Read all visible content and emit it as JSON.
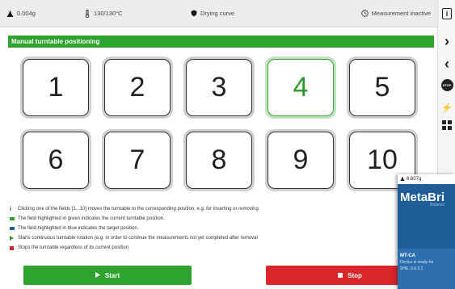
{
  "status_bar": {
    "weight": "0.004g",
    "temperature": "130/130°C",
    "drying_curve": "Drying curve",
    "measurement": "Measurement inactive"
  },
  "panel": {
    "title": "Manual turntable positioning",
    "active_position": "4",
    "positions": [
      "1",
      "2",
      "3",
      "4",
      "5",
      "6",
      "7",
      "8",
      "9",
      "10"
    ]
  },
  "legend": {
    "info": "Clicking one of the fields [1...10] moves the turntable to the corresponding position, e.g. for inserting or removing",
    "green": "The field highlighted in green indicates the current turntable position.",
    "blue": "The field highlighted in blue indicates the target position.",
    "start": "Starts continuous turntable rotation (e.g. in order to continue the measurements not yet completed after removal",
    "stop": "Stops the turntable regardless of its current position"
  },
  "buttons": {
    "start_label": "Start",
    "stop_label": "Stop"
  },
  "sidebar": {
    "info": "i",
    "forward": "›",
    "back": "‹",
    "stop_badge": "STOP",
    "power": "⚡"
  },
  "overlay_card": {
    "weight": "6.607g",
    "logo": "MetaBri",
    "sub": "Balance",
    "model": "MT-CA",
    "status_line1": "Device is ready for",
    "status_line2": "SHE: 0.6.3.1"
  },
  "colors": {
    "green": "#2ea32e",
    "red": "#d9262b",
    "blue": "#1f5d99",
    "active_border": "#3aa83a"
  }
}
